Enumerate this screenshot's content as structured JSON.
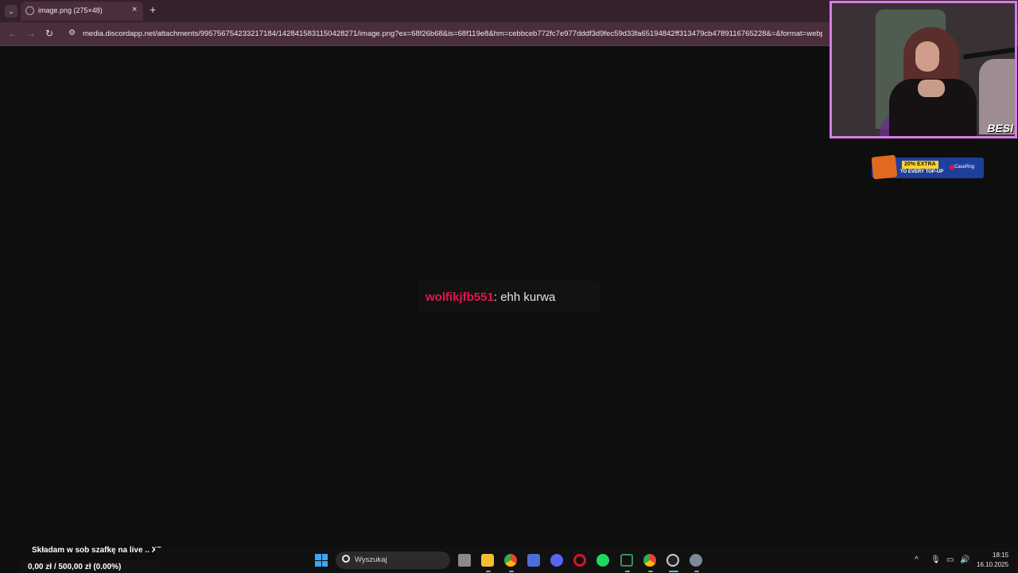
{
  "browser": {
    "tab_title": "image.png (275×48)",
    "tab_close": "×",
    "new_tab": "+",
    "tab_list": "⌄",
    "url": "media.discordapp.net/attachments/995756754233217184/1428415831150428271/image.png?ex=68f26b68&is=68f119e8&hm=cebbceb772fc7e977dddf3d9fec59d33fa65194842ff313479cb4789116765228&=&format=webp...",
    "back_icon": "←",
    "forward_icon": "→",
    "reload_icon": "↻",
    "site_info_icon": "⚙"
  },
  "image": {
    "username": "wolfikjfb551",
    "message": ": ehh kurwa",
    "username_color": "#e0164e"
  },
  "webcam": {
    "tag": "BESI",
    "border_color": "#d87be8"
  },
  "promo": {
    "badge": "20% EXTRA",
    "sub": "TO EVERY TOP-UP",
    "brand": "CaseRng"
  },
  "goal": {
    "title": "Składam w sob szafkę na live .. XD",
    "current": "0,00 zł",
    "separator": "/",
    "target": "500,00 zł",
    "percent": "(0.00%)"
  },
  "taskbar": {
    "search_placeholder": "Wyszukaj",
    "apps": [
      "task-view-icon",
      "file-explorer-icon",
      "chrome-icon",
      "calculator-icon",
      "discord-icon",
      "opera-icon",
      "spotify-icon",
      "excel-icon",
      "chrome-icon",
      "obs-icon",
      "settings-icon"
    ],
    "tray_up": "^",
    "tray_mic": "🎙",
    "tray_display": "▭",
    "tray_volume": "🔊",
    "time": "18:15",
    "date": "16.10.2025"
  }
}
